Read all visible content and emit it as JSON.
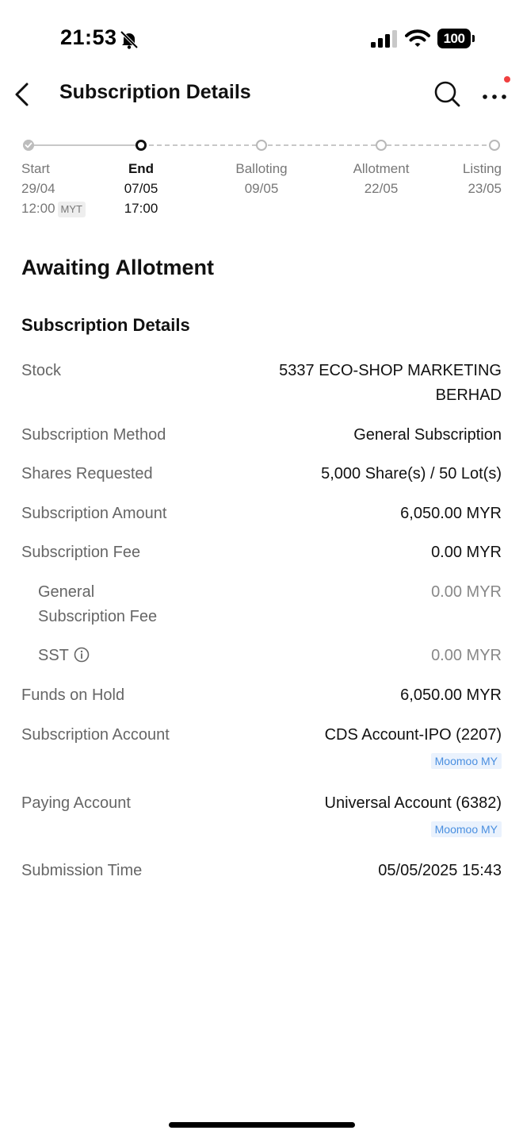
{
  "status_bar": {
    "time": "21:53",
    "battery": "100",
    "icons": [
      "bell-slash-icon",
      "signal-icon",
      "wifi-icon",
      "battery-icon"
    ]
  },
  "nav": {
    "title": "Subscription Details",
    "icons": [
      "chevron-left-icon",
      "search-icon",
      "more-icon"
    ]
  },
  "timeline": {
    "steps": [
      {
        "label": "Start",
        "date": "29/04",
        "time": "12:00",
        "tz": "MYT",
        "state": "done"
      },
      {
        "label": "End",
        "date": "07/05",
        "time": "17:00",
        "state": "current"
      },
      {
        "label": "Balloting",
        "date": "09/05",
        "state": "future"
      },
      {
        "label": "Allotment",
        "date": "22/05",
        "state": "future"
      },
      {
        "label": "Listing",
        "date": "23/05",
        "state": "future"
      }
    ]
  },
  "status": "Awaiting Allotment",
  "section_title": "Subscription Details",
  "details": {
    "stock": {
      "label": "Stock",
      "value_line1": "5337 ECO-SHOP MARKETING",
      "value_line2": "BERHAD"
    },
    "method": {
      "label": "Subscription Method",
      "value": "General Subscription"
    },
    "shares": {
      "label": "Shares Requested",
      "value": "5,000 Share(s) / 50 Lot(s)"
    },
    "amount": {
      "label": "Subscription Amount",
      "value": "6,050.00 MYR"
    },
    "fee": {
      "label": "Subscription Fee",
      "value": "0.00 MYR"
    },
    "general_fee": {
      "label_line1": "General",
      "label_line2": "Subscription Fee",
      "value": "0.00 MYR"
    },
    "sst": {
      "label": "SST",
      "value": "0.00 MYR"
    },
    "funds": {
      "label": "Funds on Hold",
      "value": "6,050.00 MYR"
    },
    "sub_account": {
      "label": "Subscription Account",
      "value": "CDS Account-IPO (2207)",
      "tag": "Moomoo MY"
    },
    "paying_account": {
      "label": "Paying Account",
      "value": "Universal Account (6382)",
      "tag": "Moomoo MY"
    },
    "submission": {
      "label": "Submission Time",
      "value": "05/05/2025 15:43"
    }
  }
}
